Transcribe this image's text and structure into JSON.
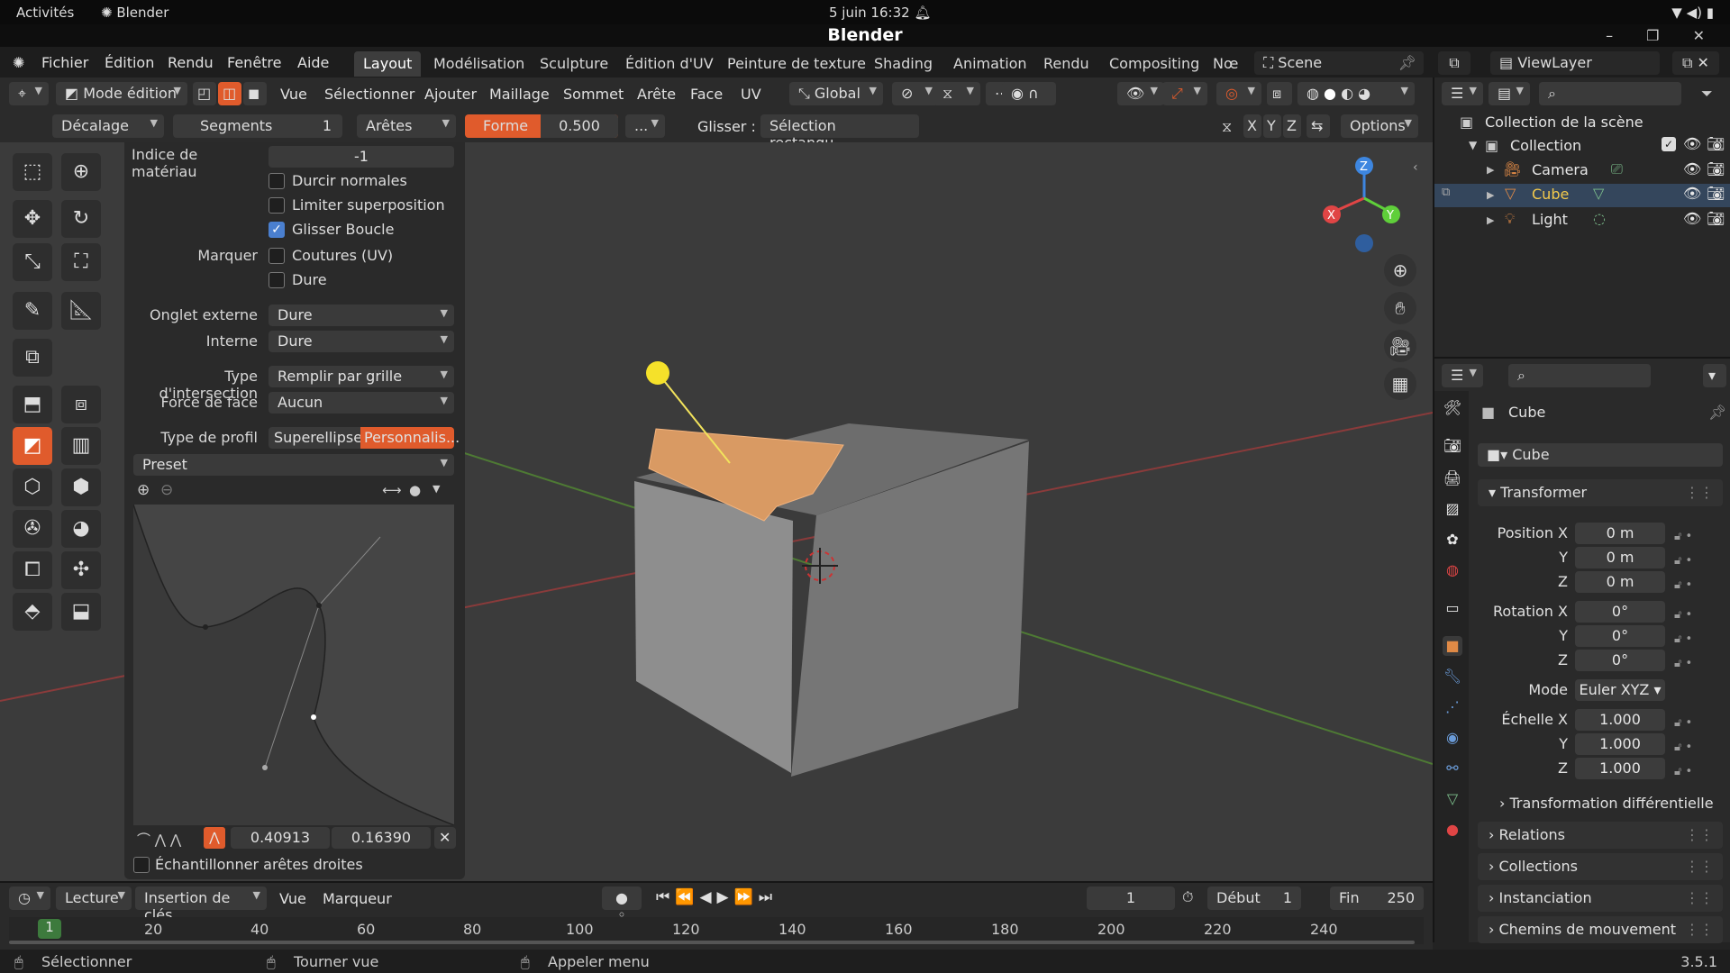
{
  "os": {
    "activities": "Activités",
    "app": "Blender",
    "clock": "5 juin  16:32",
    "tray": "▼ ◀) ▮"
  },
  "window": {
    "title": "Blender",
    "controls": "– ❐ ✕"
  },
  "menus": [
    "Fichier",
    "Édition",
    "Rendu",
    "Fenêtre",
    "Aide"
  ],
  "workspaces": [
    "Layout",
    "Modélisation",
    "Sculpture",
    "Édition d'UV",
    "Peinture de texture",
    "Shading",
    "Animation",
    "Rendu",
    "Compositing",
    "Nœ"
  ],
  "scene": {
    "label": "Scene",
    "viewlayer": "ViewLayer"
  },
  "header1": {
    "mode": "Mode édition",
    "menus": [
      "Vue",
      "Sélectionner",
      "Ajouter",
      "Maillage",
      "Sommet",
      "Arête",
      "Face",
      "UV"
    ],
    "orientation": "Global"
  },
  "header2": {
    "offset": "Décalage",
    "segments_label": "Segments",
    "segments_value": "1",
    "affect": "Arêtes",
    "shape_label": "Forme",
    "shape_value": "0.500",
    "more": "...",
    "slide_label": "Glisser :",
    "slide_value": "Sélection rectangu...",
    "axes": [
      "X",
      "Y",
      "Z"
    ],
    "options": "Options"
  },
  "redo": {
    "material_label": "Indice de matériau",
    "material_value": "-1",
    "harden": "Durcir normales",
    "clamp": "Limiter superposition",
    "loop_slide": "Glisser Boucle",
    "mark_label": "Marquer",
    "seams": "Coutures (UV)",
    "sharp": "Dure",
    "miter_outer_label": "Onglet externe",
    "miter_outer": "Dure",
    "inner_label": "Interne",
    "inner": "Dure",
    "intersect_label": "Type d'intersection",
    "intersect": "Remplir par grille",
    "face_strength_label": "Force de face",
    "face_strength": "Aucun",
    "profile_label": "Type de profil",
    "profile_super": "Superellipse",
    "profile_custom": "Personnalis...",
    "preset": "Preset",
    "curve_x": "0.40913",
    "curve_y": "0.16390",
    "sample": "Échantillonner arêtes droites"
  },
  "outliner": {
    "root": "Collection de la scène",
    "collection": "Collection",
    "items": [
      "Camera",
      "Cube",
      "Light"
    ]
  },
  "properties": {
    "object": "Cube",
    "datablock": "Cube",
    "transform": "Transformer",
    "pos_label": "Position X",
    "rot_label": "Rotation X",
    "scale_label": "Échelle X",
    "y": "Y",
    "z": "Z",
    "pos": [
      "0 m",
      "0 m",
      "0 m"
    ],
    "rot": [
      "0°",
      "0°",
      "0°"
    ],
    "mode_label": "Mode",
    "mode": "Euler XYZ",
    "scale": [
      "1.000",
      "1.000",
      "1.000"
    ],
    "delta": "Transformation différentielle",
    "sections": [
      "Relations",
      "Collections",
      "Instanciation",
      "Chemins de mouvement"
    ]
  },
  "timeline": {
    "playback": "Lecture",
    "keying": "Insertion de clés",
    "view": "Vue",
    "marker": "Marqueur",
    "frame": "1",
    "start_label": "Début",
    "start": "1",
    "end_label": "Fin",
    "end": "250",
    "ticks": [
      "1",
      "20",
      "40",
      "60",
      "80",
      "100",
      "120",
      "140",
      "160",
      "180",
      "200",
      "220",
      "240"
    ]
  },
  "status": {
    "select": "Sélectionner",
    "rotate": "Tourner vue",
    "menu": "Appeler menu",
    "version": "3.5.1"
  },
  "colors": {
    "accent": "#e05b2c",
    "selected_text": "#f2c94c",
    "axis_x": "#e04545",
    "axis_y": "#5fcf3a",
    "axis_z": "#3d86e0"
  }
}
